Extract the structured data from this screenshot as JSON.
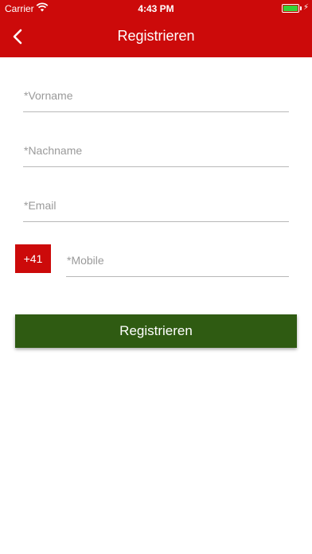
{
  "status_bar": {
    "carrier": "Carrier",
    "time": "4:43 PM",
    "wifi_icon": "wifi-icon",
    "battery_icon": "battery-charging-icon",
    "battery_color": "#37d137"
  },
  "navbar": {
    "title": "Registrieren",
    "back_icon": "chevron-left-icon",
    "background_color": "#cc0a0a"
  },
  "form": {
    "first_name": {
      "placeholder": "*Vorname",
      "value": ""
    },
    "last_name": {
      "placeholder": "*Nachname",
      "value": ""
    },
    "email": {
      "placeholder": "*Email",
      "value": ""
    },
    "country_code": "+41",
    "mobile": {
      "placeholder": "*Mobile",
      "value": ""
    },
    "submit_label": "Registrieren",
    "submit_color": "#2f5b12"
  }
}
